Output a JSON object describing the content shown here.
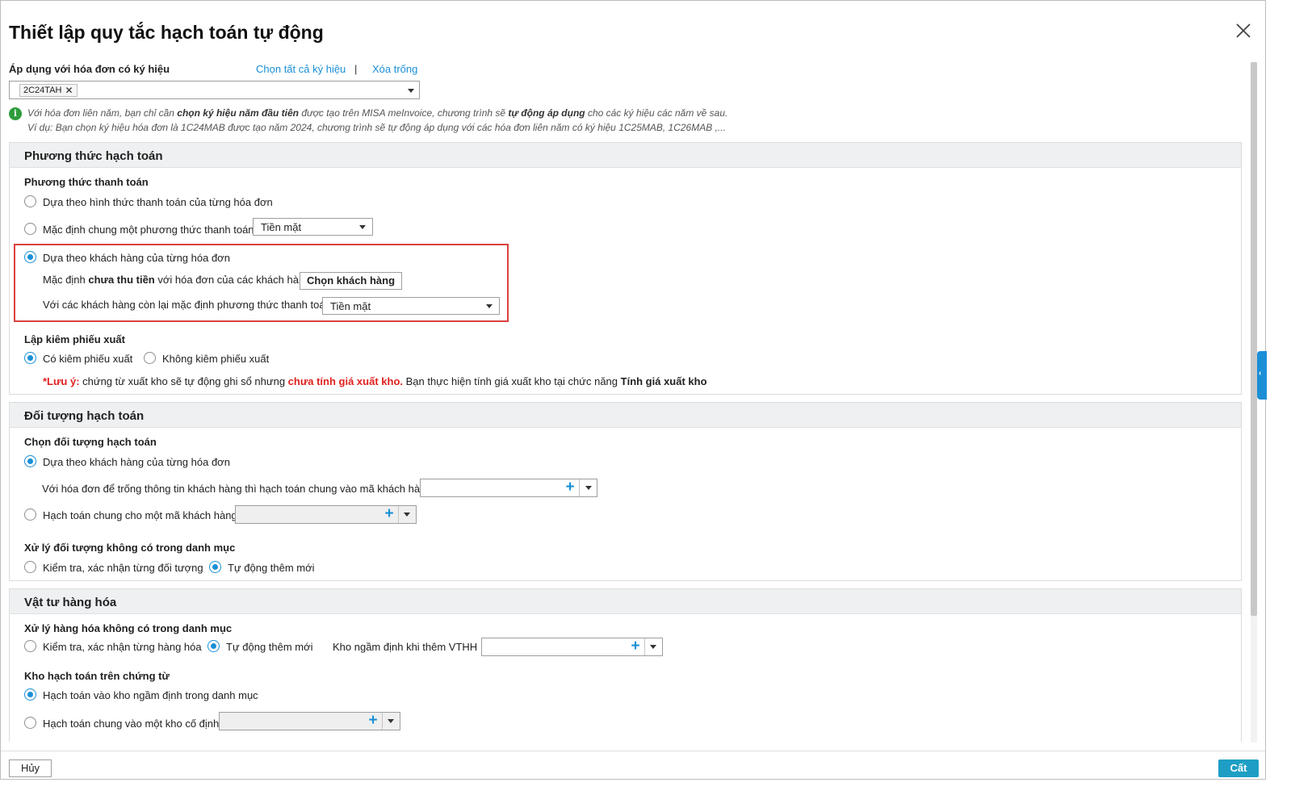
{
  "dialog": {
    "title": "Thiết lập quy tắc hạch toán tự động",
    "close_icon": "close-icon"
  },
  "apply": {
    "label": "Áp dụng với hóa đơn có ký hiệu",
    "select_all_link": "Chọn tất cả ký hiệu",
    "separator": "|",
    "clear_link": "Xóa trống",
    "tag_value": "2C24TAH",
    "tag_remove": "✕"
  },
  "info": {
    "icon": "info-icon",
    "line1_a": "Với hóa đơn liên năm, bạn chỉ cần ",
    "line1_b": "chọn ký hiệu năm đầu tiên",
    "line1_c": " được tạo trên MISA meInvoice, chương trình sẽ ",
    "line1_d": "tự động áp dụng",
    "line1_e": " cho các ký hiệu các năm về sau.",
    "line2": "Ví dụ: Bạn chọn ký hiệu hóa đơn là 1C24MAB được tạo năm 2024, chương trình sẽ tự động áp dụng với các hóa đơn liên năm có ký hiệu 1C25MAB, 1C26MAB ,..."
  },
  "section1": {
    "title": "Phương thức hạch toán",
    "payment_title": "Phương thức thanh toán",
    "opt_invoice_form": "Dựa theo hình thức thanh toán của từng hóa đơn",
    "opt_default_method": "Mặc định chung một phương thức thanh toán",
    "default_method_value": "Tiền mặt",
    "opt_by_customer": "Dựa theo khách hàng của từng hóa đơn",
    "unpaid_a": "Mặc định ",
    "unpaid_b": "chưa thu tiền",
    "unpaid_c": " với hóa đơn của các khách hàng",
    "choose_customer_button": "Chọn khách hàng",
    "remaining_label": "Với các khách hàng còn lại mặc định phương thức thanh toán.",
    "remaining_value": "Tiền mặt",
    "export_title": "Lập kiêm phiếu xuất",
    "opt_with_export": "Có kiêm phiếu xuất",
    "opt_without_export": "Không kiêm phiếu xuất",
    "note_a": "*Lưu ý:",
    "note_b": " chứng từ xuất kho sẽ tự động ghi sổ nhưng ",
    "note_c": "chưa tính giá xuất kho.",
    "note_d": " Bạn thực hiện tính giá xuất kho tại chức năng ",
    "note_e": "Tính giá xuất kho"
  },
  "section2": {
    "title": "Đối tượng hạch toán",
    "choose_title": "Chọn đối tượng hạch toán",
    "opt_by_customer": "Dựa theo khách hàng của từng hóa đơn",
    "empty_customer_label": "Với hóa đơn để trống thông tin khách hàng thì hạch toán chung vào mã khách hàng:",
    "opt_common_customer": "Hạch toán chung cho một mã khách hàng",
    "handle_title": "Xử lý đối tượng không có trong danh mục",
    "opt_check": "Kiểm tra, xác nhận từng đối tượng",
    "opt_auto_add": "Tự động thêm mới"
  },
  "section3": {
    "title": "Vật tư hàng hóa",
    "handle_title": "Xử lý hàng hóa không có trong danh mục",
    "opt_check": "Kiểm tra, xác nhận từng hàng hóa",
    "opt_auto_add": "Tự động thêm mới",
    "default_warehouse_label": "Kho ngầm định khi thêm VTHH",
    "warehouse_title": "Kho hạch toán trên chứng từ",
    "opt_default_warehouse": "Hạch toán vào kho ngầm định trong danh mục",
    "opt_fixed_warehouse": "Hạch toán chung vào một kho cố định"
  },
  "footer": {
    "cancel": "Hủy",
    "save": "Cất"
  },
  "side_tab": "‹",
  "plus": "+",
  "colors": {
    "accent": "#1a8fd6",
    "highlight_border": "#d9423c",
    "save_button": "#1e9ec4",
    "warning_red": "#e02020"
  }
}
